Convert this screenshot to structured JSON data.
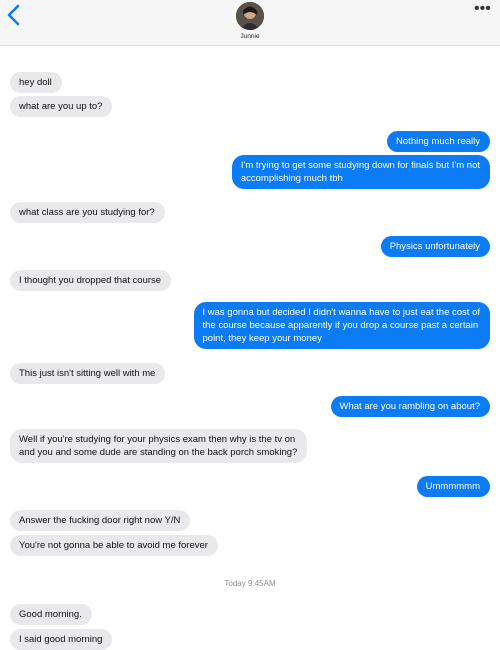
{
  "header": {
    "contact_name": "Junnie"
  },
  "timestamp": {
    "day": "Today",
    "time": "9:45AM"
  },
  "messages": [
    {
      "from": "them",
      "text": "hey doll"
    },
    {
      "from": "them",
      "text": "what are you up to?"
    },
    {
      "from": "me",
      "text": "Nothing much really"
    },
    {
      "from": "me",
      "lines": [
        "I'm trying to get some studying down for finals but I'm not",
        "accomplishing much tbh"
      ]
    },
    {
      "from": "them",
      "text": "what class are you studying for?"
    },
    {
      "from": "me",
      "text": "Physics unfortunately"
    },
    {
      "from": "them",
      "text": "I thought you dropped that course"
    },
    {
      "from": "me",
      "lines": [
        "I was gonna but decided I didn't wanna have to just eat the cost of",
        "the course because apparently if you drop a course past a certain",
        "point, they keep your money"
      ]
    },
    {
      "from": "them",
      "text": "This just isn't sitting well with me"
    },
    {
      "from": "me",
      "text": "What are you rambling on about?"
    },
    {
      "from": "them",
      "lines": [
        "Well if you're studying for your physics exam then why is the tv on",
        "and you and some dude are standing on the back porch smoking?"
      ]
    },
    {
      "from": "me",
      "text": "Ummmmmm"
    },
    {
      "from": "them",
      "text": "Answer the fucking door right now Y/N"
    },
    {
      "from": "them",
      "text": "You're not gonna be able to avoid me forever"
    },
    {
      "from": "them",
      "text": "Good morning."
    },
    {
      "from": "them",
      "text": "I said good morning"
    }
  ]
}
